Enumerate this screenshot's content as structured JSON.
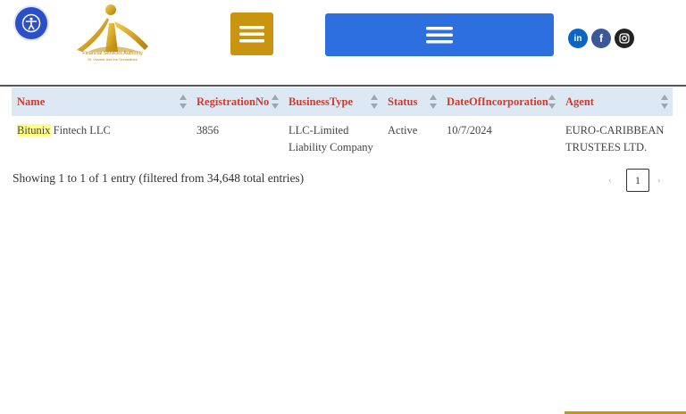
{
  "header": {
    "accessibility": {
      "icon": "accessibility-icon"
    },
    "logo": {
      "line1": "Financial Services Authority",
      "line2": "St. Vincent and the Grenadines"
    },
    "menu_gold": {
      "icon": "hamburger-icon",
      "color": "#c99410"
    },
    "menu_blue": {
      "icon": "hamburger-icon",
      "color": "#2e6fe0"
    },
    "social": [
      {
        "label": "in",
        "icon": "linkedin-icon",
        "color": "#0a66c2"
      },
      {
        "label": "f",
        "icon": "facebook-icon",
        "color": "#3b5998"
      },
      {
        "label": "",
        "icon": "instagram-icon",
        "color": "#222222"
      }
    ]
  },
  "table": {
    "columns": [
      "Name",
      "RegistrationNo",
      "BusinessType",
      "Status",
      "DateOfIncorporation",
      "Agent"
    ],
    "rows": [
      {
        "name_highlight": "Bitunix",
        "name_rest": " Fintech LLC",
        "registration_no": "3856",
        "business_type_l1": "LLC-Limited",
        "business_type_l2": "Liability Company",
        "status": "Active",
        "date": "10/7/2024",
        "agent_l1": "EURO-CARIBBEAN",
        "agent_l2": "TRUSTEES LTD."
      }
    ]
  },
  "footer": {
    "info": "Showing 1 to 1 of 1 entry (filtered from 34,648 total entries)",
    "pagination": {
      "prev": "‹",
      "current": "1",
      "next": "›"
    }
  },
  "colors": {
    "header_text": "#d43a2c",
    "header_bg": "#dce9f5",
    "accent_gold": "#c99410"
  }
}
